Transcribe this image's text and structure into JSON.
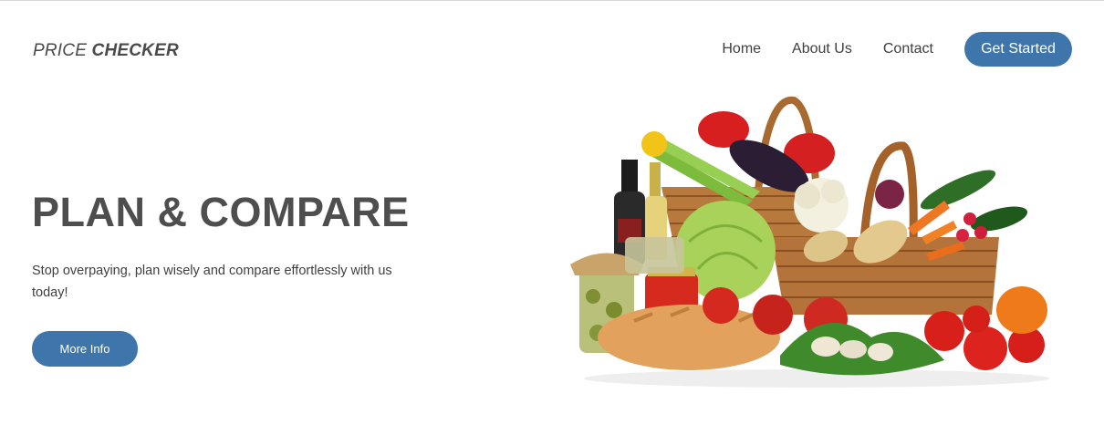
{
  "brand": {
    "light": "PRICE ",
    "bold": "CHECKER"
  },
  "nav": {
    "items": [
      {
        "label": "Home"
      },
      {
        "label": "About Us"
      },
      {
        "label": "Contact"
      }
    ],
    "cta_label": "Get Started"
  },
  "hero": {
    "title": "PLAN & COMPARE",
    "text": "Stop overpaying, plan wisely and compare effortlessly with us today!",
    "button_label": "More Info",
    "image_icon": "grocery-basket-icon"
  },
  "colors": {
    "accent": "#3e76ab",
    "text": "#4d4d4d",
    "background": "#ffffff"
  }
}
